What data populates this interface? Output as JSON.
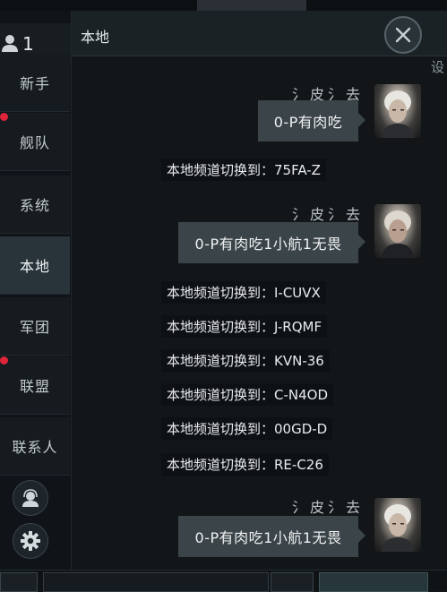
{
  "online": {
    "count": "1"
  },
  "nav": {
    "items": [
      {
        "label": "新手",
        "active": false,
        "badge": false
      },
      {
        "label": "舰队",
        "active": false,
        "badge": true
      },
      {
        "label": "系统",
        "active": false,
        "badge": false
      },
      {
        "label": "本地",
        "active": true,
        "badge": false
      },
      {
        "label": "军团",
        "active": false,
        "badge": false
      },
      {
        "label": "联盟",
        "active": false,
        "badge": true
      },
      {
        "label": "联系人",
        "active": false,
        "badge": false
      }
    ]
  },
  "header": {
    "title": "本地",
    "right_cut": "设"
  },
  "messages": {
    "m1": {
      "sender": "氵皮氵去",
      "text": "0-P有肉吃"
    },
    "s1": "本地频道切换到：75FA-Z",
    "m2": {
      "sender": "氵皮氵去",
      "text": "0-P有肉吃1小航1无畏"
    },
    "s2": "本地频道切换到：I-CUVX",
    "s3": "本地频道切换到：J-RQMF",
    "s4": "本地频道切换到：KVN-36",
    "s5": "本地频道切换到：C-N4OD",
    "s6": "本地频道切换到：00GD-D",
    "s7": "本地频道切换到：RE-C26",
    "m3": {
      "sender": "氵皮氵去",
      "text": "0-P有肉吃1小航1无畏"
    }
  },
  "colors": {
    "badge": "#e0243a",
    "active_tab": "#28343a",
    "bubble": "#3b4448"
  }
}
